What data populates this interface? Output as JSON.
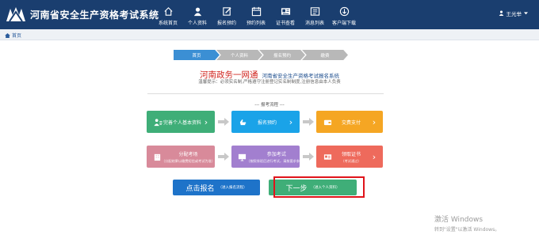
{
  "header": {
    "site_title": "河南省安全生产资格考试系统",
    "nav": [
      {
        "label": "系统首页",
        "icon": "home-icon"
      },
      {
        "label": "个人资料",
        "icon": "user-icon"
      },
      {
        "label": "报名预约",
        "icon": "edit-icon"
      },
      {
        "label": "预约列表",
        "icon": "calendar-icon"
      },
      {
        "label": "证书查看",
        "icon": "certificate-icon"
      },
      {
        "label": "消息列表",
        "icon": "message-icon"
      },
      {
        "label": "客户端下载",
        "icon": "download-icon"
      }
    ],
    "user_name": "王光举"
  },
  "breadcrumb": {
    "home": "首页"
  },
  "steps": [
    {
      "label": "首页",
      "active": true
    },
    {
      "label": "个人资料",
      "active": false
    },
    {
      "label": "报名预约",
      "active": false
    },
    {
      "label": "缴费",
      "active": false
    }
  ],
  "headline": {
    "red": "河南政务一网通",
    "blue": "河南省安全生产资格考试报名系统"
  },
  "tip": "温馨提示：必须实名制,严格遵守注册登记实名制制度,注册信息由本人负责",
  "flow_title": "--- 报考流程 ---",
  "flow": {
    "row1": [
      {
        "title": "完善个人基本资料",
        "sub": "",
        "color": "#3fae78",
        "icon": "user-card-icon"
      },
      {
        "title": "报名预约",
        "sub": "",
        "color": "#1aa3e8",
        "icon": "hand-icon"
      },
      {
        "title": "交费支付",
        "sub": "",
        "color": "#f5a623",
        "icon": "wallet-icon"
      }
    ],
    "row2": [
      {
        "title": "分配考场",
        "sub": "（分配结果以缴费短信或考试为准）",
        "color": "#d88a9a",
        "icon": "building-icon"
      },
      {
        "title": "参加考试",
        "sub": "（按照排班后进行考试，请按要求参加）",
        "color": "#a27fcf",
        "icon": "monitor-icon"
      },
      {
        "title": "领取证书",
        "sub": "（考试通过）",
        "color": "#ee6a5c",
        "icon": "certificate-card-icon"
      }
    ]
  },
  "buttons": {
    "signup": {
      "label": "点击报名",
      "sub": "（进入报名流程）"
    },
    "next": {
      "label": "下一步",
      "sub": "（进入个人资料）"
    }
  },
  "watermark": {
    "line1": "激活 Windows",
    "line2": "转到\"设置\"以激活 Windows。"
  },
  "colors": {
    "topbar": "#1a3e6f",
    "signup": "#1e73c9",
    "next": "#3fae78",
    "highlight": "#e0141b"
  }
}
